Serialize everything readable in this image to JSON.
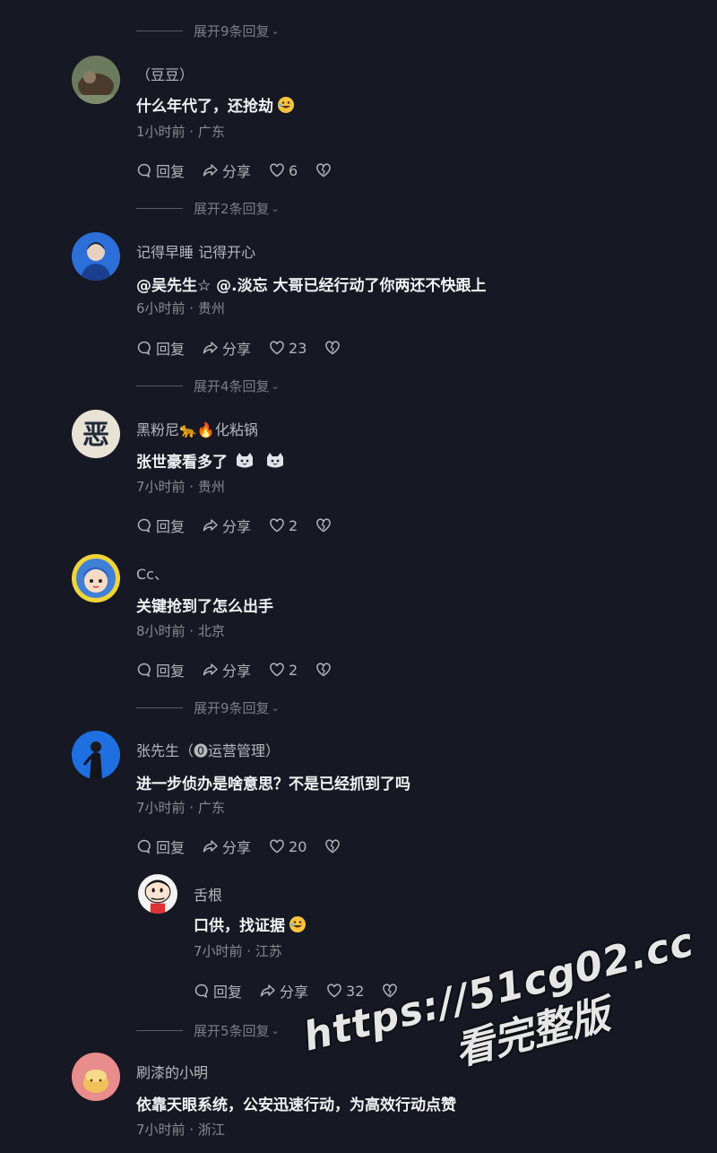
{
  "expand_rows": [
    "展开9条回复",
    "展开2条回复",
    "展开4条回复",
    "展开9条回复",
    "展开5条回复"
  ],
  "actions": {
    "reply": "回复",
    "share": "分享"
  },
  "comments": [
    {
      "user": "（豆豆）",
      "text": "什么年代了，还抢劫",
      "emoji": "rofl",
      "meta": "1小时前 · 广东",
      "likes": "6"
    },
    {
      "user": "记得早睡 记得开心",
      "text": "@吴先生☆  @.淡忘  大哥已经行动了你两还不快跟上",
      "meta": "6小时前 · 贵州",
      "likes": "23"
    },
    {
      "user": "黑粉尼🐆🔥化粘锅",
      "text": "张世豪看多了",
      "emoji": "cat",
      "meta": "7小时前 · 贵州",
      "likes": "2"
    },
    {
      "user": "Cc、",
      "text": "关键抢到了怎么出手",
      "meta": "8小时前 · 北京",
      "likes": "2"
    },
    {
      "user": "张先生（⓿运营管理）",
      "text": "进一步侦办是啥意思？不是已经抓到了吗",
      "meta": "7小时前 · 广东",
      "likes": "20"
    },
    {
      "user": "舌根",
      "text": "口供，找证据",
      "emoji": "rofl",
      "meta": "7小时前 · 江苏",
      "likes": "32"
    },
    {
      "user": "刷漆的小明",
      "text": "依靠天眼系统，公安迅速行动，为高效行动点赞",
      "meta": "7小时前 · 浙江"
    }
  ],
  "watermark": {
    "line1": "https://51cg02.cc",
    "line2": "看完整版"
  },
  "colors": {
    "background": "#161823",
    "meta": "#8a8b91",
    "username": "#b7b8bd"
  }
}
